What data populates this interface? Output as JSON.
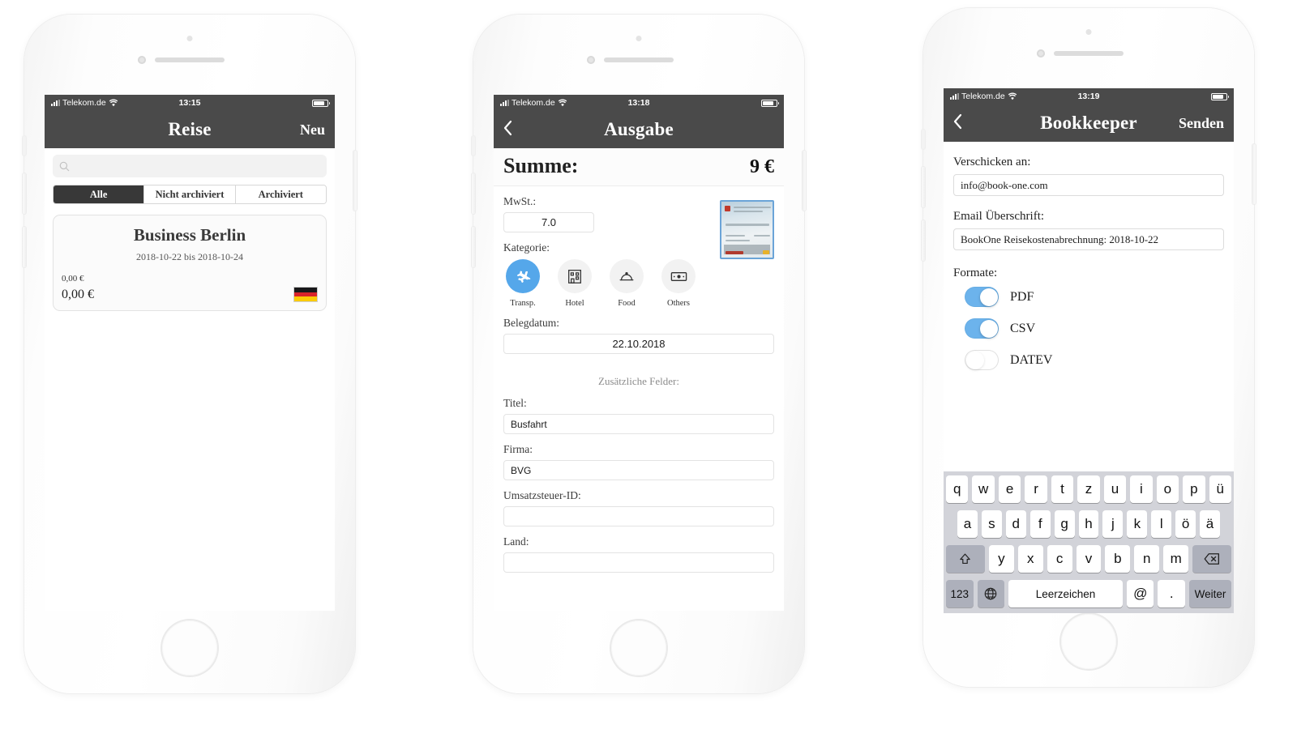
{
  "phones": [
    {
      "id": "trips",
      "status": {
        "carrier": "Telekom.de",
        "time": "13:15",
        "signal_icon": "signal-bars-icon",
        "wifi_icon": "wifi-icon",
        "battery_icon": "battery-icon"
      },
      "navbar": {
        "title": "Reise",
        "right_action": "Neu"
      },
      "search": {
        "placeholder": "",
        "value": "",
        "icon": "search-icon"
      },
      "segments": [
        {
          "label": "Alle",
          "selected": true
        },
        {
          "label": "Nicht archiviert",
          "selected": false
        },
        {
          "label": "Archiviert",
          "selected": false
        }
      ],
      "trip_card": {
        "title": "Business Berlin",
        "dates": "2018-10-22 bis 2018-10-24",
        "amount_small": "0,00 €",
        "amount_large": "0,00 €",
        "flag_icon": "german-flag-icon"
      }
    },
    {
      "id": "expense",
      "status": {
        "carrier": "Telekom.de",
        "time": "13:18",
        "signal_icon": "signal-bars-icon",
        "wifi_icon": "wifi-icon",
        "battery_icon": "battery-icon"
      },
      "navbar": {
        "back_icon": "chevron-left-icon",
        "title": "Ausgabe"
      },
      "summary": {
        "label": "Summe:",
        "value": "9 €"
      },
      "vat": {
        "label": "MwSt.:",
        "value": "7.0"
      },
      "receipt_thumb": {
        "name": "receipt-thumbnail"
      },
      "category": {
        "label": "Kategorie:",
        "options": [
          {
            "label": "Transp.",
            "icon": "airplane-icon",
            "selected": true
          },
          {
            "label": "Hotel",
            "icon": "hotel-building-icon",
            "selected": false
          },
          {
            "label": "Food",
            "icon": "food-cloche-icon",
            "selected": false
          },
          {
            "label": "Others",
            "icon": "banknote-icon",
            "selected": false
          }
        ]
      },
      "receipt_date": {
        "label": "Belegdatum:",
        "value": "22.10.2018"
      },
      "extra_header": "Zusätzliche Felder:",
      "extra_fields": [
        {
          "label": "Titel:",
          "value": "Busfahrt"
        },
        {
          "label": "Firma:",
          "value": "BVG"
        },
        {
          "label": "Umsatzsteuer-ID:",
          "value": ""
        },
        {
          "label": "Land:",
          "value": ""
        }
      ]
    },
    {
      "id": "bookkeeper",
      "status": {
        "carrier": "Telekom.de",
        "time": "13:19",
        "signal_icon": "signal-bars-icon",
        "wifi_icon": "wifi-icon",
        "battery_icon": "battery-icon"
      },
      "navbar": {
        "back_icon": "chevron-left-icon",
        "title": "Bookkeeper",
        "right_action": "Senden"
      },
      "send_to": {
        "label": "Verschicken an:",
        "value": "info@book-one.com"
      },
      "subject": {
        "label": "Email Überschrift:",
        "value": "BookOne Reisekostenabrechnung: 2018-10-22"
      },
      "formats": {
        "label": "Formate:",
        "items": [
          {
            "label": "PDF",
            "on": true
          },
          {
            "label": "CSV",
            "on": true
          },
          {
            "label": "DATEV",
            "on": false
          }
        ]
      },
      "keyboard": {
        "row1": [
          "q",
          "w",
          "e",
          "r",
          "t",
          "z",
          "u",
          "i",
          "o",
          "p",
          "ü"
        ],
        "row2": [
          "a",
          "s",
          "d",
          "f",
          "g",
          "h",
          "j",
          "k",
          "l",
          "ö",
          "ä"
        ],
        "row3_shift_icon": "shift-up-arrow-icon",
        "row3": [
          "y",
          "x",
          "c",
          "v",
          "b",
          "n",
          "m"
        ],
        "row3_backspace_icon": "backspace-icon",
        "numbers_key": "123",
        "globe_icon": "globe-icon",
        "space_key": "Leerzeichen",
        "at_key": "@",
        "period_key": ".",
        "return_key": "Weiter"
      }
    }
  ],
  "colors": {
    "navbar": "#4a4a4a",
    "accent_blue": "#55a7ea",
    "toggle_on": "#6cb3ec",
    "segment_active": "#383838",
    "keyboard_bg": "#d2d3d9"
  }
}
